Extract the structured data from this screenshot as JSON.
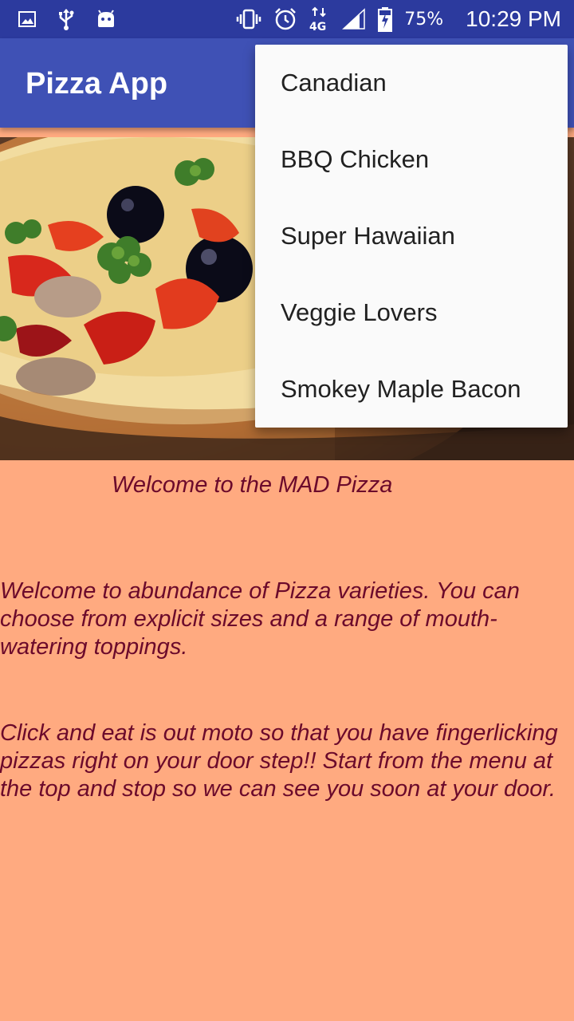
{
  "status_bar": {
    "battery_percent": "75%",
    "time": "10:29 PM",
    "icons": [
      "image-icon",
      "usb-icon",
      "android-icon",
      "vibrate-icon",
      "alarm-icon",
      "network-4g-icon",
      "signal-icon",
      "battery-charging-icon"
    ]
  },
  "app_bar": {
    "title": "Pizza App"
  },
  "hero": {
    "image": "pizza-photo"
  },
  "content": {
    "heading": "Welcome to the MAD Pizza",
    "paragraph_1": "Welcome to abundance of Pizza varieties. You can choose from explicit sizes and a range of mouth-watering toppings.",
    "paragraph_2": "Click and eat is out moto so that you have fingerlicking pizzas right on your door step!! Start from the menu at the top and stop so we can see you soon at your door."
  },
  "menu": {
    "items": [
      "Canadian",
      "BBQ Chicken",
      "Super Hawaiian",
      "Veggie Lovers",
      "Smokey Maple Bacon"
    ]
  },
  "colors": {
    "status_bar": "#2c3a9e",
    "app_bar": "#3f51b5",
    "background": "#ffaa80",
    "text": "#6b0a2b",
    "menu_bg": "#fafafa"
  }
}
